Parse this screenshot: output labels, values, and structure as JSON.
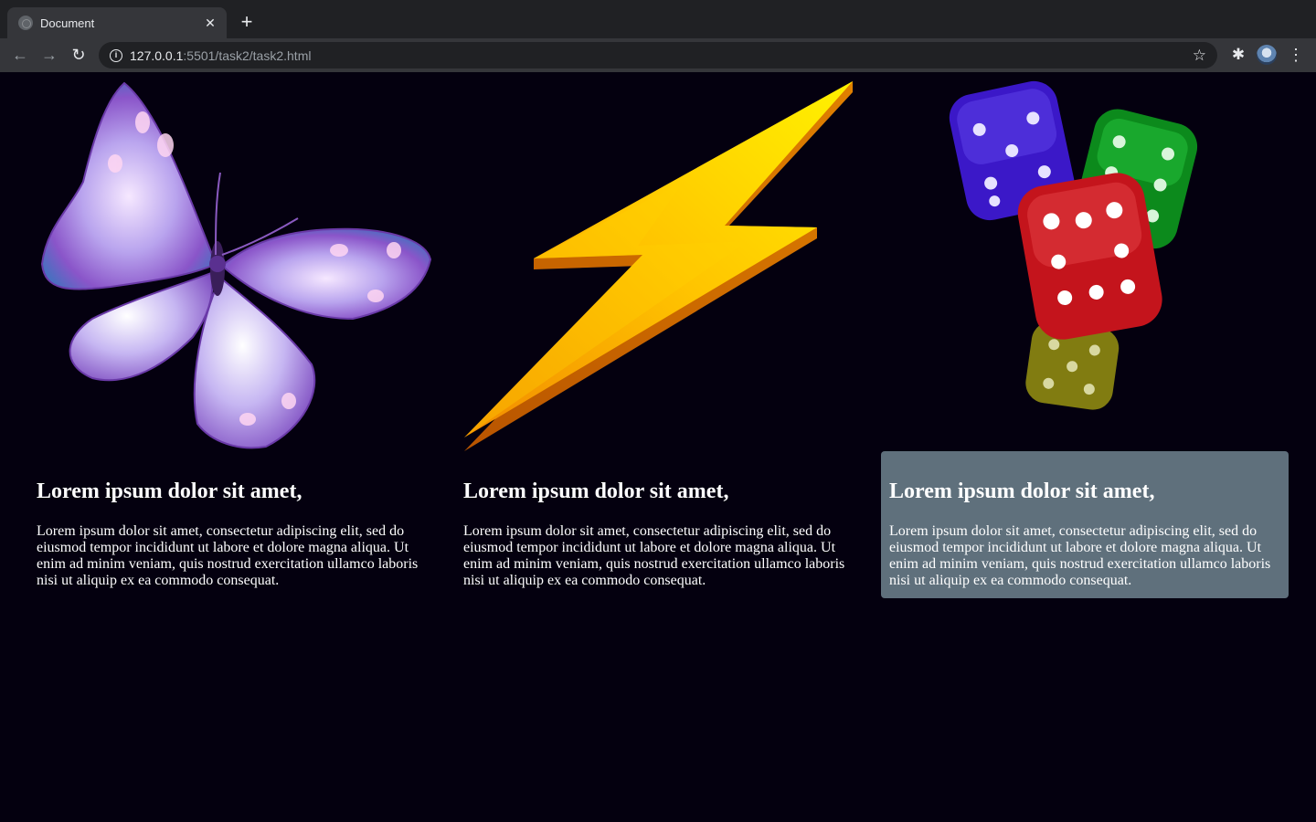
{
  "browser": {
    "tab_title": "Document",
    "tab_close": "✕",
    "new_tab": "+",
    "url_host": "127.0.0.1",
    "url_rest": ":5501/task2/task2.html",
    "back": "←",
    "forward": "→",
    "reload": "↻",
    "info": "i",
    "star": "☆",
    "extensions": "✱",
    "menu": "⋮"
  },
  "cards": [
    {
      "image_icon": "butterfly-image",
      "title": "Lorem ipsum dolor sit amet,",
      "text": "Lorem ipsum dolor sit amet, consectetur adipiscing elit, sed do eiusmod tempor incididunt ut labore et dolore magna aliqua. Ut enim ad minim veniam, quis nostrud exercitation ullamco laboris nisi ut aliquip ex ea commodo consequat."
    },
    {
      "image_icon": "lightning-bolt-image",
      "title": "Lorem ipsum dolor sit amet,",
      "text": "Lorem ipsum dolor sit amet, consectetur adipiscing elit, sed do eiusmod tempor incididunt ut labore et dolore magna aliqua. Ut enim ad minim veniam, quis nostrud exercitation ullamco laboris nisi ut aliquip ex ea commodo consequat."
    },
    {
      "image_icon": "dice-image",
      "title": "Lorem ipsum dolor sit amet,",
      "text": "Lorem ipsum dolor sit amet, consectetur adipiscing elit, sed do eiusmod tempor incididunt ut labore et dolore magna aliqua. Ut enim ad minim veniam, quis nostrud exercitation ullamco laboris nisi ut aliquip ex ea commodo consequat."
    }
  ],
  "colors": {
    "page_background": "#04000f",
    "highlighted_card": "#5f707c",
    "chrome_dark": "#202124",
    "chrome_toolbar": "#35363a"
  }
}
